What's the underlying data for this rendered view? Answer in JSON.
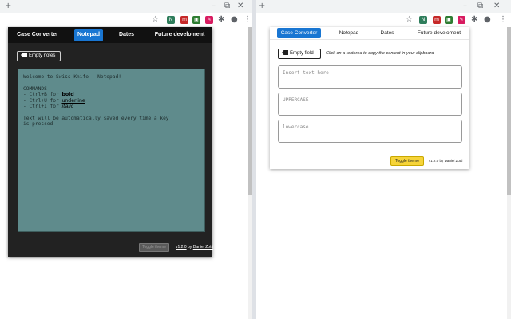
{
  "browser": {
    "new_tab_icon": "plus-icon",
    "window_controls": [
      "minimize-icon",
      "restore-icon",
      "close-icon"
    ],
    "toolbar_icons": [
      "star-icon",
      "extension-icon",
      "puzzle-icon",
      "profile-icon",
      "menu-dots-icon"
    ]
  },
  "dark_popup": {
    "nav": {
      "tabs": [
        {
          "label": "Case Converter"
        },
        {
          "label": "Notepad"
        },
        {
          "label": "Dates"
        },
        {
          "label": "Future develoment"
        }
      ],
      "active_tab": "Notepad"
    },
    "empty_notes_label": "Empty notes",
    "notepad_lines": {
      "l1": "Welcome to Swiss Knife - Notepad!",
      "l3": "COMMANDS",
      "l4_prefix": "- Ctrl+B for ",
      "l4_word": "bold",
      "l5_prefix": "- Ctrl+U for ",
      "l5_word": "underline",
      "l6_prefix": "- Ctrl+I for ",
      "l6_word": "italic",
      "l8": "Text will be automatically saved every time a key",
      "l9": "is pressed"
    },
    "toggle_theme_label": "Toggle theme",
    "version": "v1.2.0",
    "by": "by",
    "author": "Daniel Zotti"
  },
  "light_popup": {
    "nav": {
      "tabs": [
        {
          "label": "Case Converter"
        },
        {
          "label": "Notepad"
        },
        {
          "label": "Dates"
        },
        {
          "label": "Future develoment"
        }
      ],
      "active_tab": "Case Converter"
    },
    "empty_field_label": "Empty field",
    "hint": "Click on a textarea to copy the content in your clipboard",
    "fields": {
      "insert_placeholder": "Insert text here",
      "upper_placeholder": "UPPERCASE",
      "lower_placeholder": "lowercase"
    },
    "toggle_theme_label": "Toggle theme",
    "version": "v1.2.0",
    "by": "by",
    "author": "Daniel Zotti"
  },
  "colors": {
    "accent": "#1976d2",
    "dark_bg": "#222222",
    "notepad_bg": "#5f8b8c",
    "toggle_light": "#f6d43a"
  }
}
